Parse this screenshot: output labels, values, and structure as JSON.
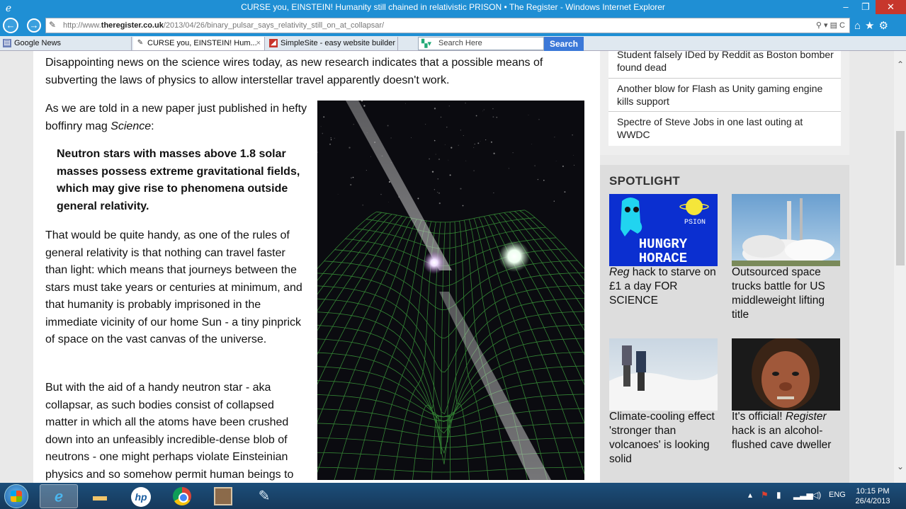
{
  "window": {
    "title": "CURSE you, EINSTEIN! Humanity still chained in relativistic PRISON • The Register - Windows Internet Explorer",
    "min": "–",
    "max": "❐",
    "close": "✕"
  },
  "address": {
    "prefix": "http://www.",
    "domain": "theregister.co.uk",
    "path": "/2013/04/26/binary_pulsar_says_relativity_still_on_at_collapsar/",
    "tools": "⚲ ▾ ▤ C"
  },
  "tabs": [
    {
      "label": "Google News"
    },
    {
      "label": "CURSE you, EINSTEIN! Hum...",
      "close": "×"
    },
    {
      "label": "SimpleSite - easy website builder"
    }
  ],
  "search": {
    "placeholder": "Search Here",
    "button": "Search"
  },
  "article": {
    "p1": "Disappointing news on the science wires today, as new research indicates that a possible means of subverting the laws of physics to allow interstellar travel apparently doesn't work.",
    "p2_pre": "As we are told in a new paper just published in hefty boffinry mag ",
    "p2_em": "Science",
    "p2_post": ":",
    "quote": "Neutron stars with masses above 1.8 solar masses possess extreme gravitational fields, which may give rise to phenomena outside general relativity.",
    "p3": "That would be quite handy, as one of the rules of general relativity is that nothing can travel faster than light: which means that journeys between the stars must take years or centuries at minimum, and that humanity is probably imprisoned in the immediate vicinity of our home Sun - a tiny pinprick of space on the vast canvas of the universe.",
    "p4": "But with the aid of a handy neutron star - aka collapsar, as such bodies consist of collapsed matter in which all the atoms have been crushed down into an unfeasibly incredible-dense blob of neutrons - one might perhaps violate Einsteinian physics and so somehow permit human beings to"
  },
  "related": [
    "Student falsely IDed by Reddit as Boston bomber found dead",
    "Another blow for Flash as Unity gaming engine kills support",
    "Spectre of Steve Jobs in one last outing at WWDC"
  ],
  "spotlight": {
    "title": "SPOTLIGHT",
    "items": [
      {
        "em": "Reg",
        "text": " hack to starve on £1 a day FOR SCIENCE"
      },
      {
        "em": "",
        "text": "Outsourced space trucks battle for US middleweight lifting title"
      },
      {
        "em": "",
        "text": "Climate-cooling effect 'stronger than volcanoes' is looking solid"
      },
      {
        "pre": "It's official! ",
        "em": "Register",
        "text": " hack is an alcohol-flushed cave dweller"
      }
    ],
    "horace_line1": "HUNGRY",
    "horace_line2": "HORACE",
    "psion": "PSION"
  },
  "taskbar": {
    "lang": "ENG",
    "time": "10:15 PM",
    "date": "26/4/2013"
  }
}
